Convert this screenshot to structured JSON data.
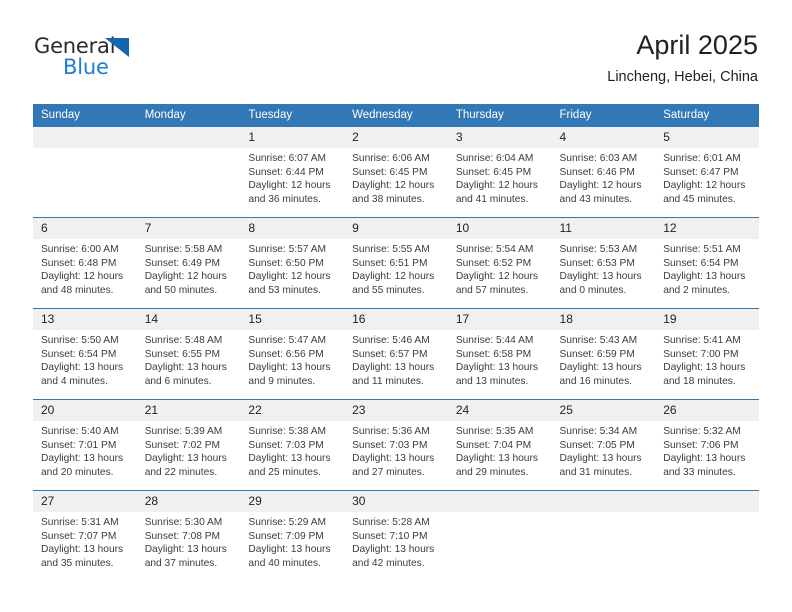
{
  "logo": {
    "word1": "General",
    "word2": "Blue",
    "triangle_color": "#1666ae",
    "word2_color": "#1b7fd4"
  },
  "header": {
    "title": "April 2025",
    "subtitle": "Lincheng, Hebei, China"
  },
  "theme": {
    "header_blue": "#3277b6",
    "daynum_band": "#f0f0f0",
    "text": "#231f20"
  },
  "weekdays": [
    "Sunday",
    "Monday",
    "Tuesday",
    "Wednesday",
    "Thursday",
    "Friday",
    "Saturday"
  ],
  "weeks": [
    [
      {
        "day": "",
        "blank": true
      },
      {
        "day": "",
        "blank": true
      },
      {
        "day": "1",
        "sunrise": "Sunrise: 6:07 AM",
        "sunset": "Sunset: 6:44 PM",
        "daylight1": "Daylight: 12 hours",
        "daylight2": "and 36 minutes."
      },
      {
        "day": "2",
        "sunrise": "Sunrise: 6:06 AM",
        "sunset": "Sunset: 6:45 PM",
        "daylight1": "Daylight: 12 hours",
        "daylight2": "and 38 minutes."
      },
      {
        "day": "3",
        "sunrise": "Sunrise: 6:04 AM",
        "sunset": "Sunset: 6:45 PM",
        "daylight1": "Daylight: 12 hours",
        "daylight2": "and 41 minutes."
      },
      {
        "day": "4",
        "sunrise": "Sunrise: 6:03 AM",
        "sunset": "Sunset: 6:46 PM",
        "daylight1": "Daylight: 12 hours",
        "daylight2": "and 43 minutes."
      },
      {
        "day": "5",
        "sunrise": "Sunrise: 6:01 AM",
        "sunset": "Sunset: 6:47 PM",
        "daylight1": "Daylight: 12 hours",
        "daylight2": "and 45 minutes."
      }
    ],
    [
      {
        "day": "6",
        "sunrise": "Sunrise: 6:00 AM",
        "sunset": "Sunset: 6:48 PM",
        "daylight1": "Daylight: 12 hours",
        "daylight2": "and 48 minutes."
      },
      {
        "day": "7",
        "sunrise": "Sunrise: 5:58 AM",
        "sunset": "Sunset: 6:49 PM",
        "daylight1": "Daylight: 12 hours",
        "daylight2": "and 50 minutes."
      },
      {
        "day": "8",
        "sunrise": "Sunrise: 5:57 AM",
        "sunset": "Sunset: 6:50 PM",
        "daylight1": "Daylight: 12 hours",
        "daylight2": "and 53 minutes."
      },
      {
        "day": "9",
        "sunrise": "Sunrise: 5:55 AM",
        "sunset": "Sunset: 6:51 PM",
        "daylight1": "Daylight: 12 hours",
        "daylight2": "and 55 minutes."
      },
      {
        "day": "10",
        "sunrise": "Sunrise: 5:54 AM",
        "sunset": "Sunset: 6:52 PM",
        "daylight1": "Daylight: 12 hours",
        "daylight2": "and 57 minutes."
      },
      {
        "day": "11",
        "sunrise": "Sunrise: 5:53 AM",
        "sunset": "Sunset: 6:53 PM",
        "daylight1": "Daylight: 13 hours",
        "daylight2": "and 0 minutes."
      },
      {
        "day": "12",
        "sunrise": "Sunrise: 5:51 AM",
        "sunset": "Sunset: 6:54 PM",
        "daylight1": "Daylight: 13 hours",
        "daylight2": "and 2 minutes."
      }
    ],
    [
      {
        "day": "13",
        "sunrise": "Sunrise: 5:50 AM",
        "sunset": "Sunset: 6:54 PM",
        "daylight1": "Daylight: 13 hours",
        "daylight2": "and 4 minutes."
      },
      {
        "day": "14",
        "sunrise": "Sunrise: 5:48 AM",
        "sunset": "Sunset: 6:55 PM",
        "daylight1": "Daylight: 13 hours",
        "daylight2": "and 6 minutes."
      },
      {
        "day": "15",
        "sunrise": "Sunrise: 5:47 AM",
        "sunset": "Sunset: 6:56 PM",
        "daylight1": "Daylight: 13 hours",
        "daylight2": "and 9 minutes."
      },
      {
        "day": "16",
        "sunrise": "Sunrise: 5:46 AM",
        "sunset": "Sunset: 6:57 PM",
        "daylight1": "Daylight: 13 hours",
        "daylight2": "and 11 minutes."
      },
      {
        "day": "17",
        "sunrise": "Sunrise: 5:44 AM",
        "sunset": "Sunset: 6:58 PM",
        "daylight1": "Daylight: 13 hours",
        "daylight2": "and 13 minutes."
      },
      {
        "day": "18",
        "sunrise": "Sunrise: 5:43 AM",
        "sunset": "Sunset: 6:59 PM",
        "daylight1": "Daylight: 13 hours",
        "daylight2": "and 16 minutes."
      },
      {
        "day": "19",
        "sunrise": "Sunrise: 5:41 AM",
        "sunset": "Sunset: 7:00 PM",
        "daylight1": "Daylight: 13 hours",
        "daylight2": "and 18 minutes."
      }
    ],
    [
      {
        "day": "20",
        "sunrise": "Sunrise: 5:40 AM",
        "sunset": "Sunset: 7:01 PM",
        "daylight1": "Daylight: 13 hours",
        "daylight2": "and 20 minutes."
      },
      {
        "day": "21",
        "sunrise": "Sunrise: 5:39 AM",
        "sunset": "Sunset: 7:02 PM",
        "daylight1": "Daylight: 13 hours",
        "daylight2": "and 22 minutes."
      },
      {
        "day": "22",
        "sunrise": "Sunrise: 5:38 AM",
        "sunset": "Sunset: 7:03 PM",
        "daylight1": "Daylight: 13 hours",
        "daylight2": "and 25 minutes."
      },
      {
        "day": "23",
        "sunrise": "Sunrise: 5:36 AM",
        "sunset": "Sunset: 7:03 PM",
        "daylight1": "Daylight: 13 hours",
        "daylight2": "and 27 minutes."
      },
      {
        "day": "24",
        "sunrise": "Sunrise: 5:35 AM",
        "sunset": "Sunset: 7:04 PM",
        "daylight1": "Daylight: 13 hours",
        "daylight2": "and 29 minutes."
      },
      {
        "day": "25",
        "sunrise": "Sunrise: 5:34 AM",
        "sunset": "Sunset: 7:05 PM",
        "daylight1": "Daylight: 13 hours",
        "daylight2": "and 31 minutes."
      },
      {
        "day": "26",
        "sunrise": "Sunrise: 5:32 AM",
        "sunset": "Sunset: 7:06 PM",
        "daylight1": "Daylight: 13 hours",
        "daylight2": "and 33 minutes."
      }
    ],
    [
      {
        "day": "27",
        "sunrise": "Sunrise: 5:31 AM",
        "sunset": "Sunset: 7:07 PM",
        "daylight1": "Daylight: 13 hours",
        "daylight2": "and 35 minutes."
      },
      {
        "day": "28",
        "sunrise": "Sunrise: 5:30 AM",
        "sunset": "Sunset: 7:08 PM",
        "daylight1": "Daylight: 13 hours",
        "daylight2": "and 37 minutes."
      },
      {
        "day": "29",
        "sunrise": "Sunrise: 5:29 AM",
        "sunset": "Sunset: 7:09 PM",
        "daylight1": "Daylight: 13 hours",
        "daylight2": "and 40 minutes."
      },
      {
        "day": "30",
        "sunrise": "Sunrise: 5:28 AM",
        "sunset": "Sunset: 7:10 PM",
        "daylight1": "Daylight: 13 hours",
        "daylight2": "and 42 minutes."
      },
      {
        "day": "",
        "blank": true
      },
      {
        "day": "",
        "blank": true
      },
      {
        "day": "",
        "blank": true
      }
    ]
  ]
}
